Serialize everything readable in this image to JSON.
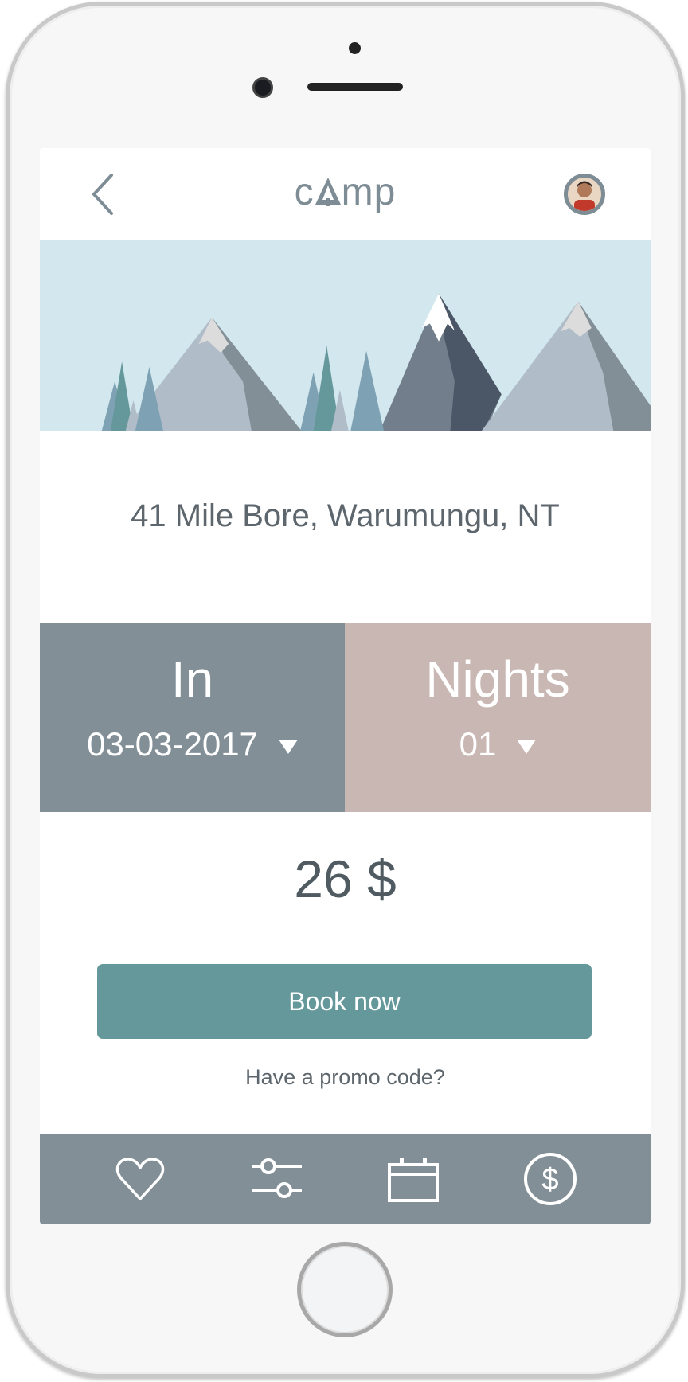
{
  "header": {
    "logo": "cAmp",
    "back_icon": "chevron-left-icon",
    "avatar": "user-avatar"
  },
  "location": {
    "address": "41 Mile Bore, Warumungu, NT"
  },
  "booking": {
    "in_label": "In",
    "in_value": "03-03-2017",
    "nights_label": "Nights",
    "nights_value": "01"
  },
  "price": "26 $",
  "book_button": "Book now",
  "promo_link": "Have a promo code?",
  "nav": [
    "heart-icon",
    "sliders-icon",
    "calendar-icon",
    "dollar-icon"
  ],
  "colors": {
    "accent": "#64989b",
    "in_block": "#828f97",
    "nights_block": "#c8b7b3",
    "sky": "#d2e7ee"
  }
}
